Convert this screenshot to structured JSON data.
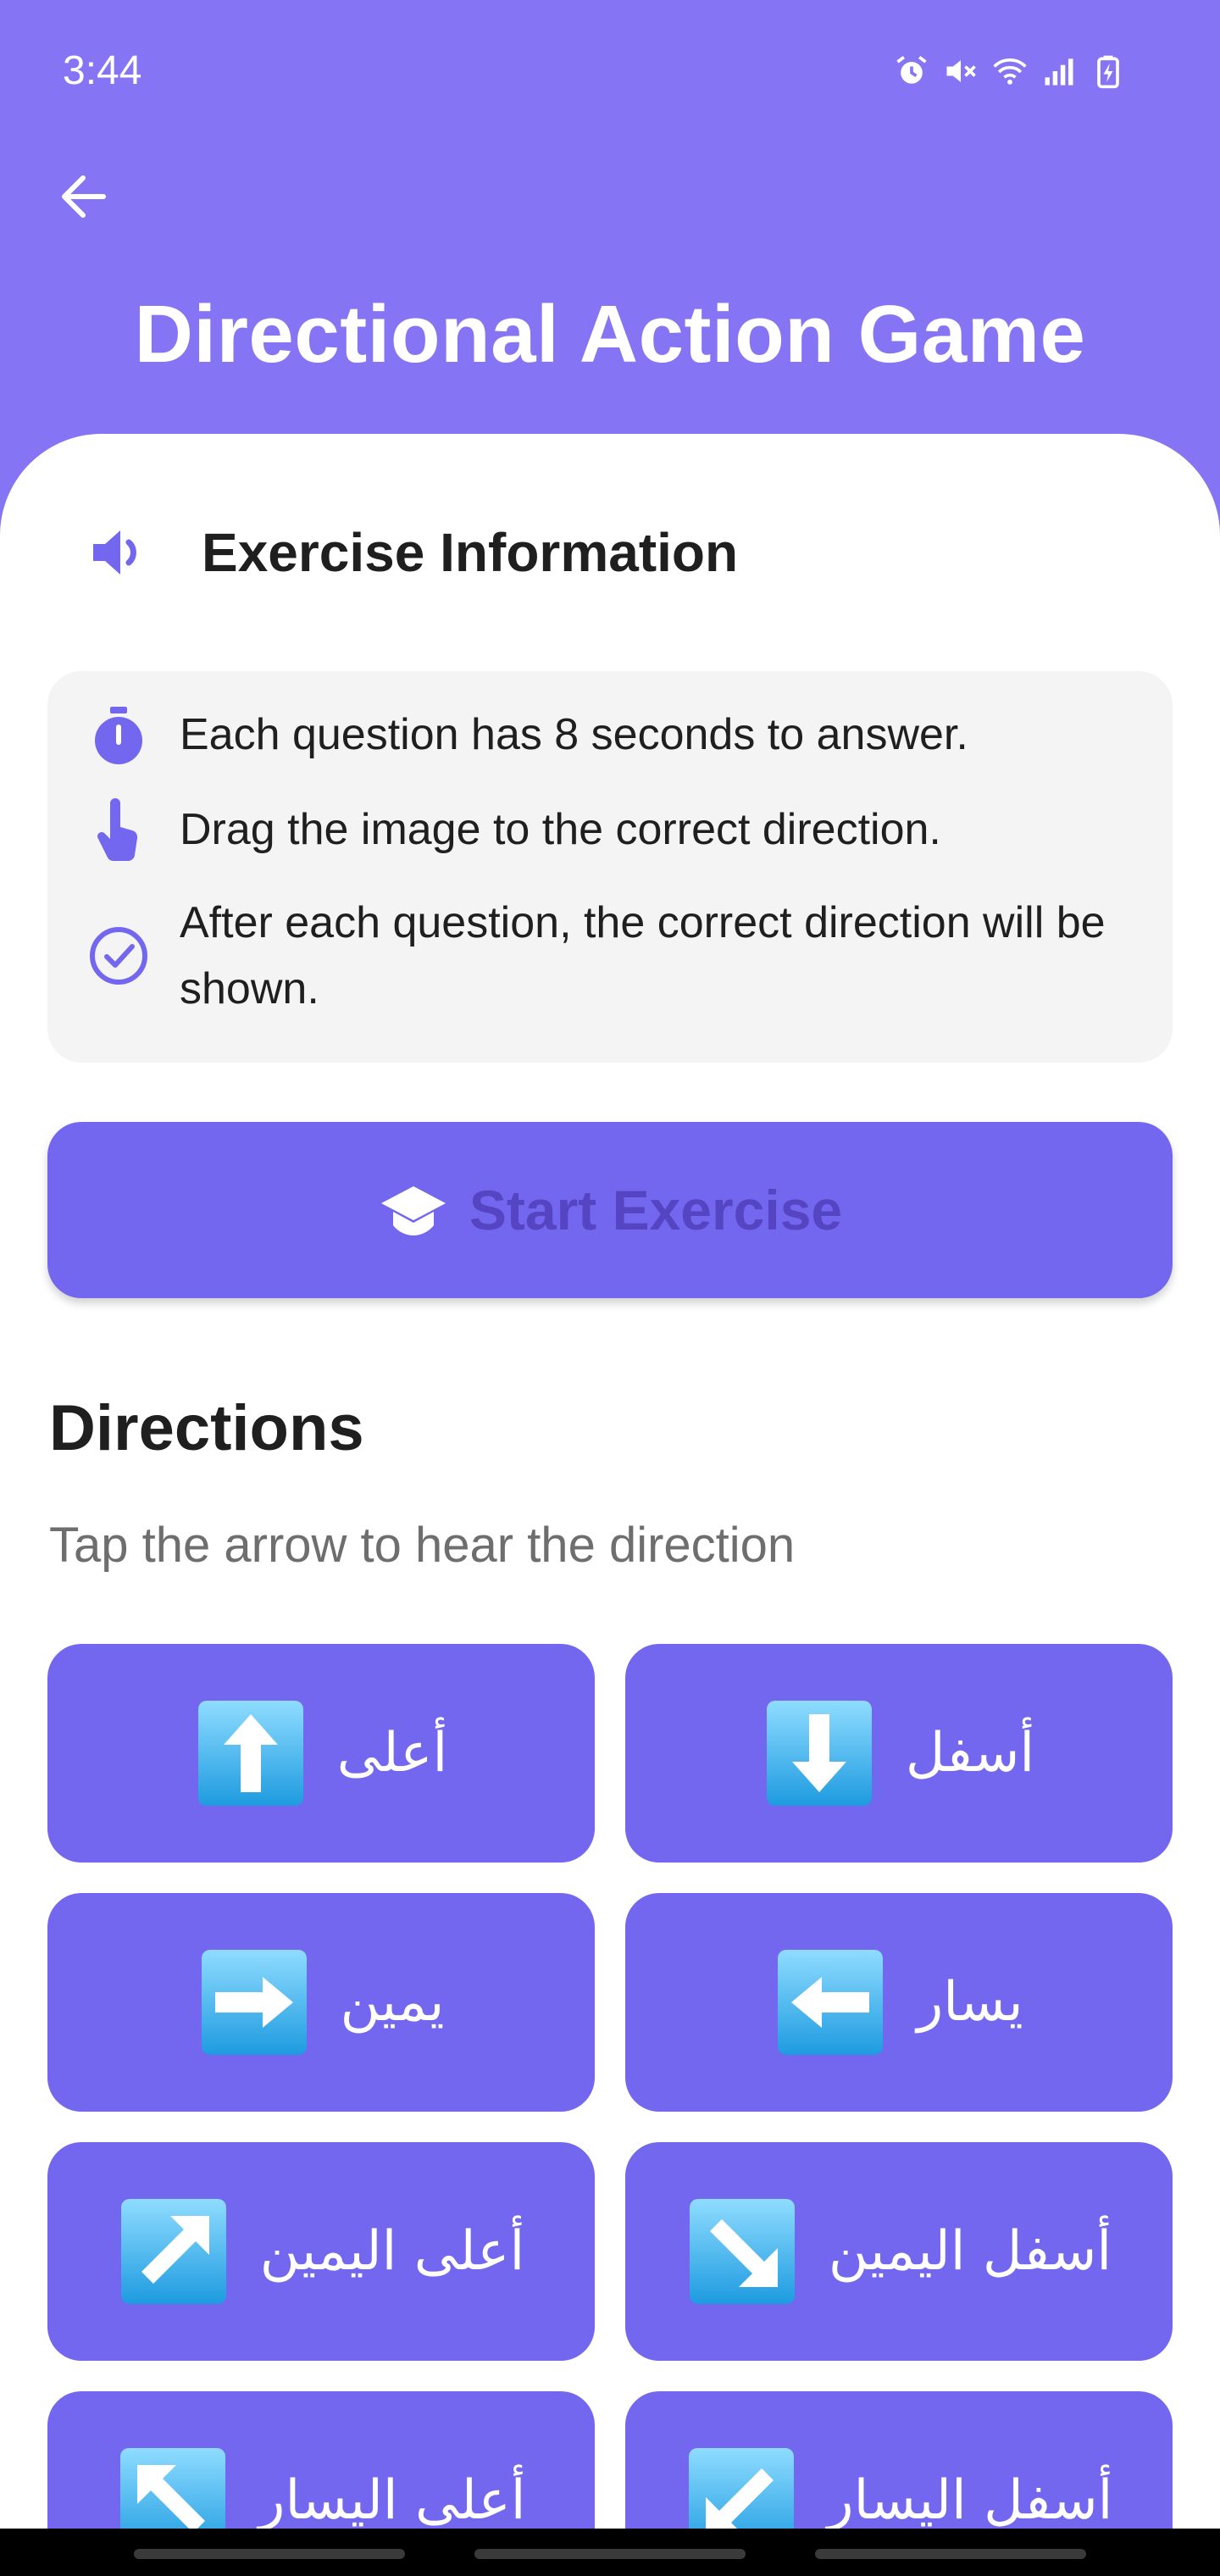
{
  "status": {
    "time": "3:44"
  },
  "header": {
    "title": "Directional Action Game"
  },
  "info": {
    "title": "Exercise Information",
    "items": [
      {
        "icon": "timer-icon",
        "text": "Each question has 8 seconds to answer."
      },
      {
        "icon": "drag-hand-icon",
        "text": "Drag the image to the correct direction."
      },
      {
        "icon": "check-circle-icon",
        "text": "After each question, the correct direction will be shown."
      }
    ]
  },
  "start_button": {
    "label": "Start Exercise"
  },
  "directions": {
    "title": "Directions",
    "subtitle": "Tap the arrow to hear the direction",
    "tiles": [
      {
        "label": "أعلى",
        "icon": "arrow-up-icon"
      },
      {
        "label": "أسفل",
        "icon": "arrow-down-icon"
      },
      {
        "label": "يمين",
        "icon": "arrow-right-icon"
      },
      {
        "label": "يسار",
        "icon": "arrow-left-icon"
      },
      {
        "label": "أعلى اليمين",
        "icon": "arrow-up-right-icon"
      },
      {
        "label": "أسفل اليمين",
        "icon": "arrow-down-right-icon"
      },
      {
        "label": "أعلى اليسار",
        "icon": "arrow-up-left-icon"
      },
      {
        "label": "أسفل اليسار",
        "icon": "arrow-down-left-icon"
      }
    ]
  },
  "colors": {
    "header_bg": "#8575f5",
    "accent": "#7467ef",
    "start_text": "#5545c2",
    "info_bg": "#f4f4f4"
  }
}
